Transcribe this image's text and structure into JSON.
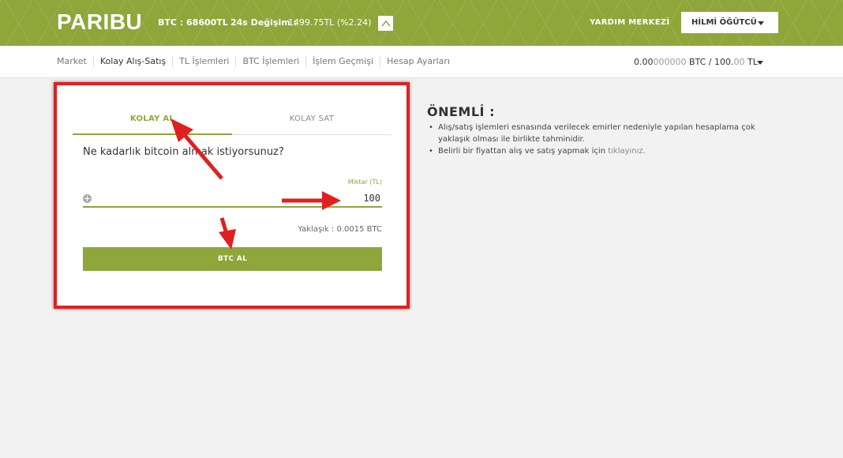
{
  "header": {
    "logo": "PARIBU",
    "btc_price": "BTC : 68600TL",
    "change_label": "24s Değişim :",
    "change_value": "1499.75TL (%2.24)",
    "help": "YARDIM MERKEZİ",
    "user": "HİLMİ ÖĞÜTCÜ"
  },
  "nav": {
    "items": [
      "Market",
      "Kolay Alış-Satış",
      "TL İşlemleri",
      "BTC İşlemleri",
      "İşlem Geçmişi",
      "Hesap Ayarları"
    ],
    "balance_btc_bold": "0.00",
    "balance_btc_muted": "000000",
    "balance_mid": " BTC / 100.",
    "balance_tl_muted": "00",
    "balance_tl_unit": " TL"
  },
  "card": {
    "tab_buy": "KOLAY AL",
    "tab_sell": "KOLAY SAT",
    "question": "Ne kadarlık bitcoin almak istiyorsunuz?",
    "amount_label": "Miktar (TL)",
    "amount_value": "100",
    "approx": "Yaklaşık : 0.0015 BTC",
    "buy_button": "BTC AL"
  },
  "important": {
    "title": "ÖNEMLİ :",
    "item1": "Alış/satış işlemleri esnasında verilecek emirler nedeniyle yapılan hesaplama çok yaklaşık olması ile birlikte tahminidir.",
    "item2_prefix": "Belirli bir fiyattan alış ve satış yapmak için ",
    "item2_link": "tıklayınız."
  },
  "colors": {
    "brand_green": "#8ea63a",
    "annotation_red": "#e02020"
  }
}
